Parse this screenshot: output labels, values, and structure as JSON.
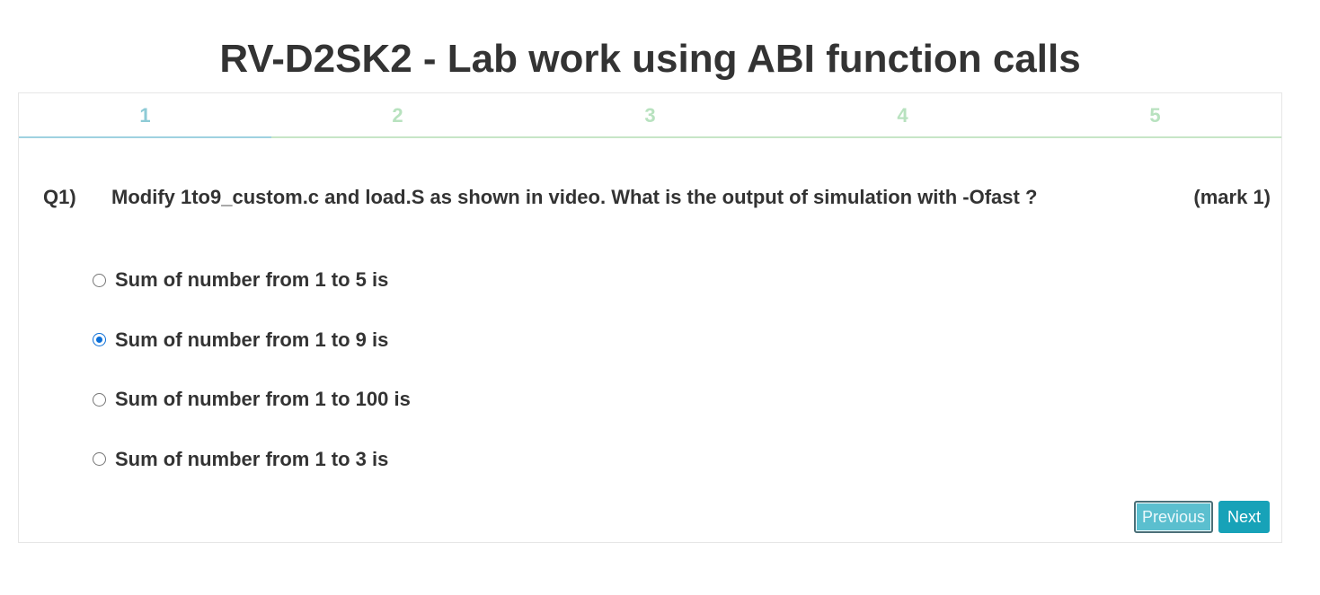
{
  "page": {
    "title": "RV-D2SK2 - Lab work using ABI function calls"
  },
  "tabs": [
    {
      "label": "1",
      "active": true
    },
    {
      "label": "2",
      "active": false
    },
    {
      "label": "3",
      "active": false
    },
    {
      "label": "4",
      "active": false
    },
    {
      "label": "5",
      "active": false
    }
  ],
  "question": {
    "number": "Q1)",
    "text": "Modify 1to9_custom.c and load.S as shown in video. What is the output of simulation with -Ofast ?",
    "mark": "(mark 1)"
  },
  "options": [
    {
      "label": "Sum of number from 1 to 5 is",
      "selected": false
    },
    {
      "label": "Sum of number from 1 to 9 is",
      "selected": true
    },
    {
      "label": "Sum of number from 1 to 100 is",
      "selected": false
    },
    {
      "label": "Sum of number from 1 to 3 is",
      "selected": false
    }
  ],
  "buttons": {
    "previous": "Previous",
    "next": "Next"
  },
  "colors": {
    "active_tab": "#8ecbd6",
    "inactive_tab": "#b8e2bf",
    "radio_selected": "#0b6fd8",
    "previous_button": "#5bbfcf",
    "next_button": "#17a2b8"
  }
}
